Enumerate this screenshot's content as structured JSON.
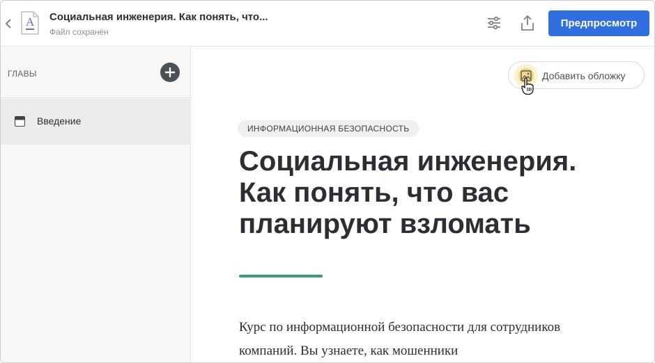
{
  "header": {
    "back_icon": "chevron-left-icon",
    "doc_icon": "document-icon",
    "doc_icon_letter": "A",
    "title": "Социальная инженерия. Как понять, что...",
    "subtitle": "Файл сохранён",
    "settings_icon": "sliders-icon",
    "share_icon": "share-icon",
    "preview_label": "Предпросмотр",
    "accent_color": "#2f6fe0"
  },
  "sidebar": {
    "chapters_label": "ГЛАВЫ",
    "add_icon": "plus-circle-icon",
    "items": [
      {
        "label": "Введение",
        "icon": "chapter-icon"
      }
    ]
  },
  "main": {
    "cover_button_label": "Добавить обложку",
    "cover_icon": "image-icon",
    "tag": "ИНФОРМАЦИОННАЯ БЕЗОПАСНОСТЬ",
    "course_title": "Социальная инженерия. Как понять, что вас планируют взломать",
    "accent_line_color": "#34a26b",
    "description": "Курс по информационной безопасности для сотрудников компаний. Вы узнаете, как мошенники"
  }
}
